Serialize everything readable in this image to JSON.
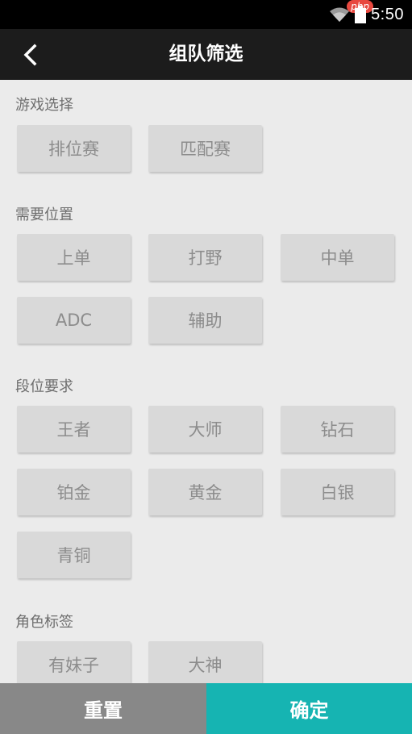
{
  "statusbar": {
    "time": "5:50",
    "badge": "php",
    "icons": [
      "wifi-icon",
      "battery-icon"
    ]
  },
  "titlebar": {
    "title": "组队筛选",
    "back_icon": "chevron-left-icon"
  },
  "sections": {
    "game": {
      "label": "游戏选择",
      "options": [
        "排位赛",
        "匹配赛"
      ]
    },
    "position": {
      "label": "需要位置",
      "options": [
        "上单",
        "打野",
        "中单",
        "ADC",
        "辅助"
      ]
    },
    "rank": {
      "label": "段位要求",
      "options": [
        "王者",
        "大师",
        "钻石",
        "铂金",
        "黄金",
        "白银",
        "青铜"
      ]
    },
    "role_tag": {
      "label": "角色标签",
      "options": [
        "有妹子",
        "大神"
      ]
    }
  },
  "bottom": {
    "reset_label": "重置",
    "confirm_label": "确定"
  },
  "colors": {
    "accent": "#16b4b2",
    "reset_bg": "#888888",
    "titlebar_bg": "#1c1c1c",
    "chip_bg": "#d9d9d9",
    "badge": "#e8483f"
  }
}
